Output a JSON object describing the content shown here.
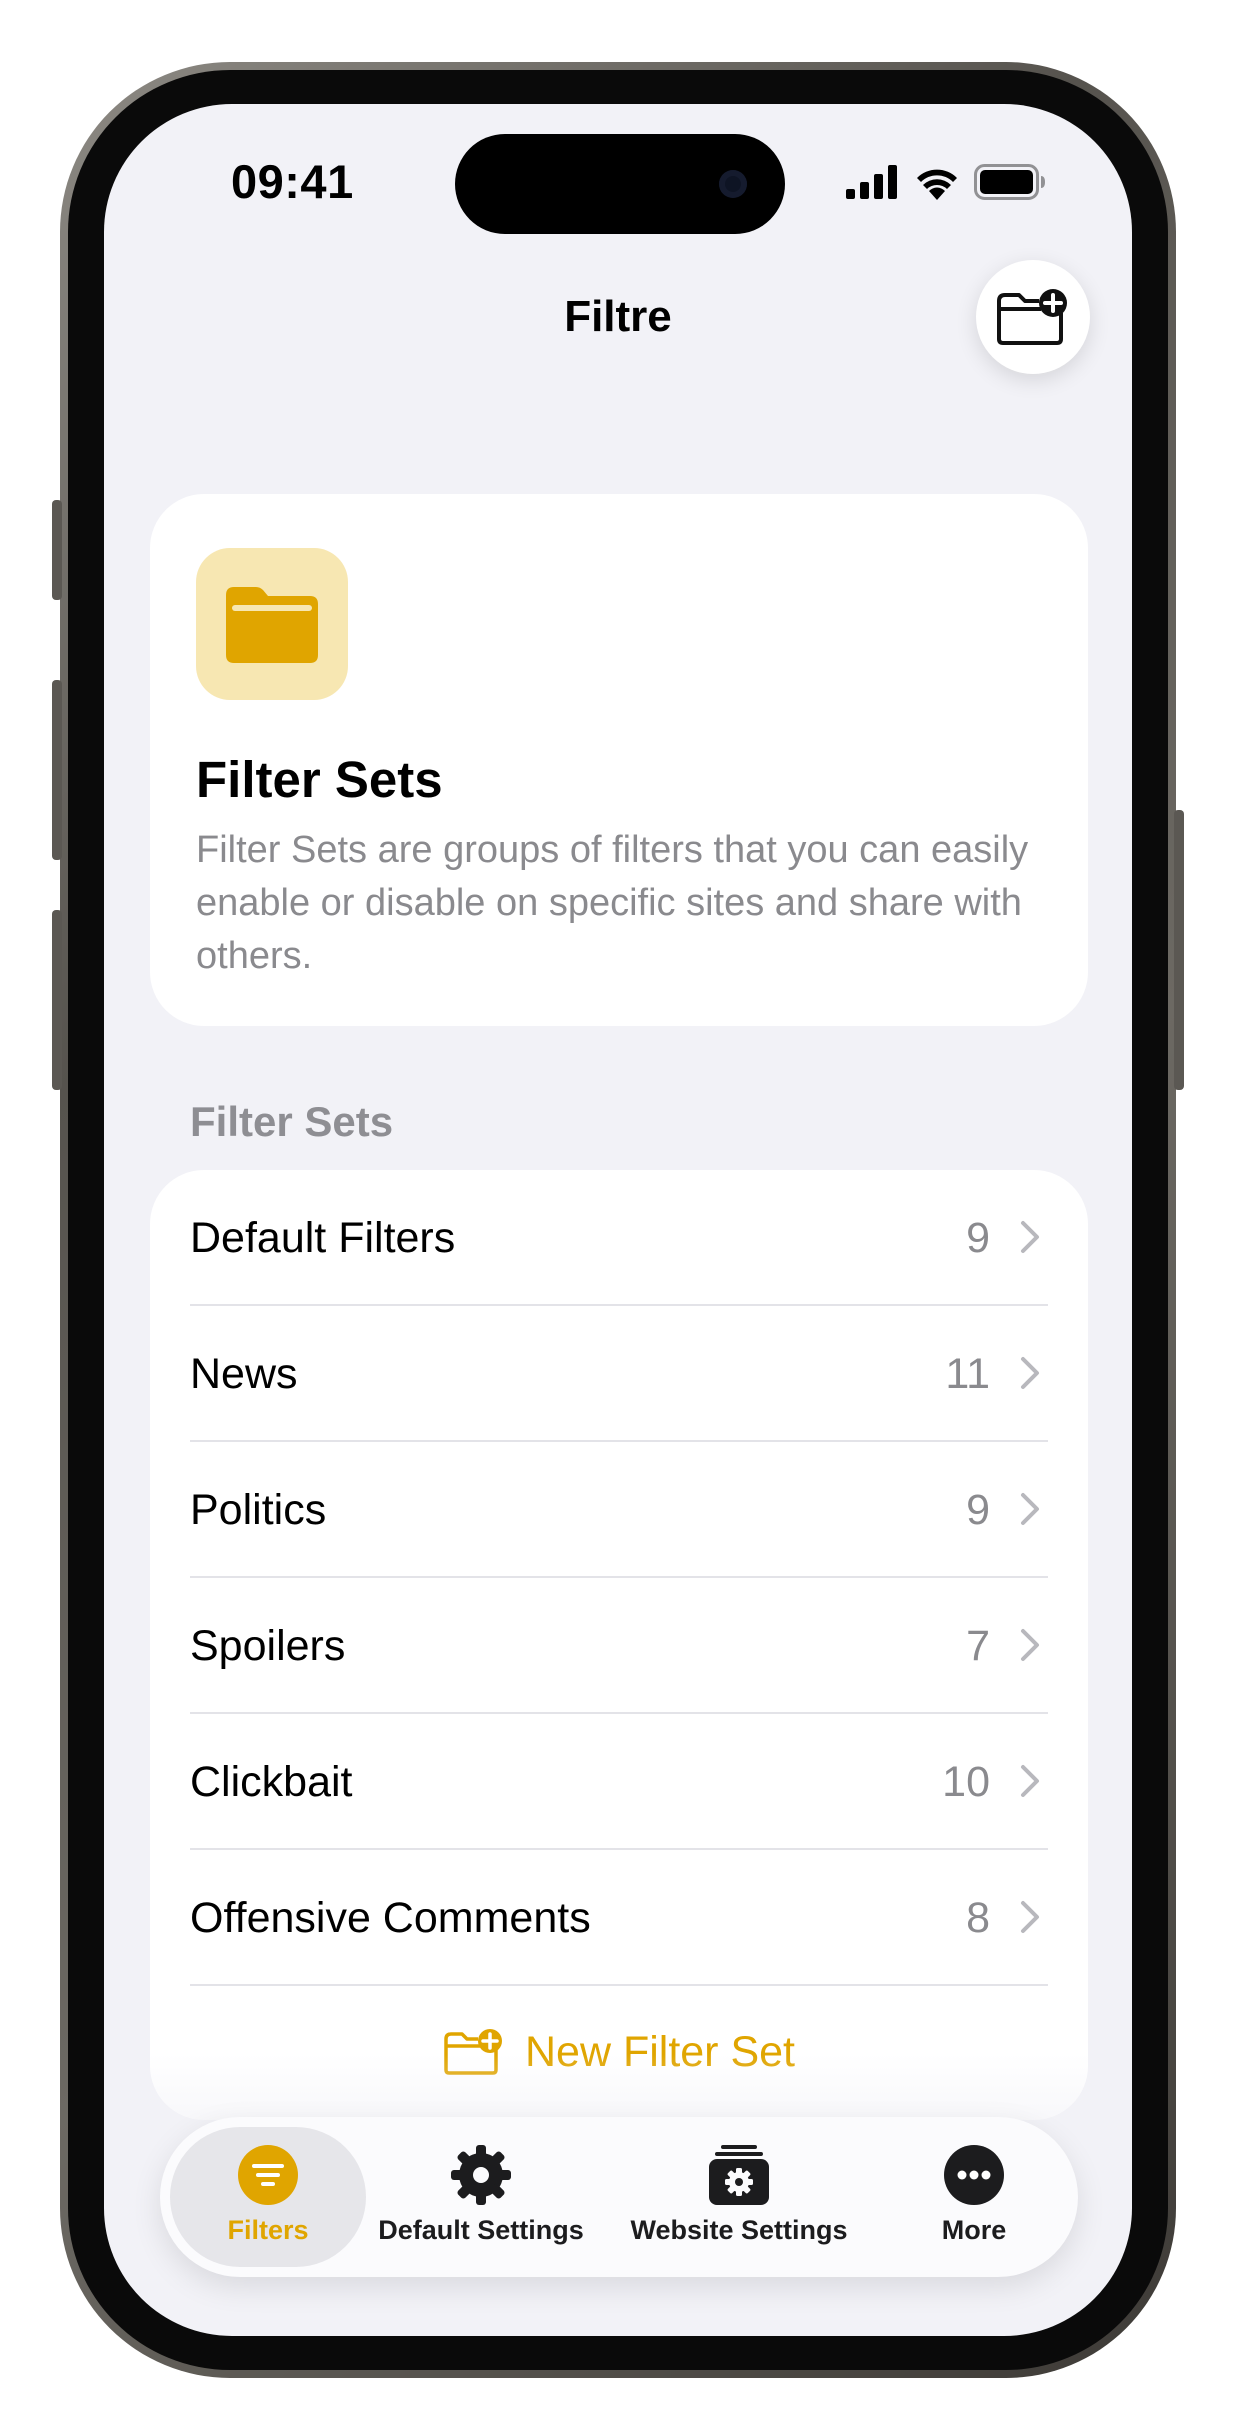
{
  "status_bar": {
    "time": "09:41",
    "icons": [
      "cellular-signal-icon",
      "wifi-icon",
      "battery-icon"
    ]
  },
  "nav": {
    "title": "Filtre",
    "add_button_icon": "folder-badge-plus-icon"
  },
  "info_card": {
    "icon": "folder-icon",
    "title": "Filter Sets",
    "description": "Filter Sets are groups of filters that you can easily enable or disable on specific sites and share with others."
  },
  "section": {
    "header": "Filter Sets",
    "rows": [
      {
        "label": "Default Filters",
        "count": "9"
      },
      {
        "label": "News",
        "count": "11"
      },
      {
        "label": "Politics",
        "count": "9"
      },
      {
        "label": "Spoilers",
        "count": "7"
      },
      {
        "label": "Clickbait",
        "count": "10"
      },
      {
        "label": "Offensive Comments",
        "count": "8"
      }
    ],
    "new_button": "New Filter Set"
  },
  "tabs": [
    {
      "label": "Filters",
      "icon": "filter-circle-icon",
      "active": true
    },
    {
      "label": "Default Settings",
      "icon": "gear-icon",
      "active": false
    },
    {
      "label": "Website Settings",
      "icon": "gear-stack-icon",
      "active": false
    },
    {
      "label": "More",
      "icon": "ellipsis-circle-icon",
      "active": false
    }
  ],
  "colors": {
    "accent": "#E0A500",
    "accent_tint": "#F7E7B2",
    "background": "#F2F2F7",
    "secondary_text": "#8A8A8E"
  }
}
